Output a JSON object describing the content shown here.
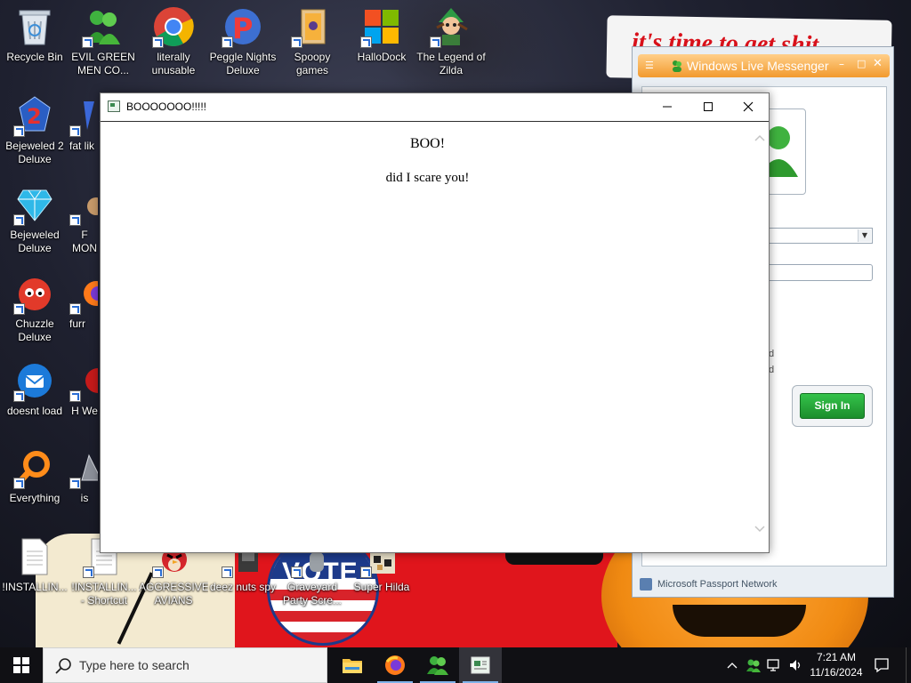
{
  "colors": {
    "taskbar": "#101014",
    "search_box": "#f3f3f3",
    "messenger_title": "#f29a2e",
    "sign_in_green": "#1c8e2c",
    "window_border": "#6f6f6f",
    "wallpaper_red": "#e0151c",
    "pumpkin_orange": "#f08a12"
  },
  "wallpaper": {
    "banner_text": "it's time to get shit",
    "vote_text": "VOTE"
  },
  "desktop_icons": [
    {
      "label": "Recycle Bin",
      "icon": "recycle-bin-icon"
    },
    {
      "label": "EVIL GREEN MEN CO...",
      "icon": "green-men-icon"
    },
    {
      "label": "literally unusable",
      "icon": "chrome-icon"
    },
    {
      "label": "Peggle Nights Deluxe",
      "icon": "peggle-icon"
    },
    {
      "label": "Spoopy games",
      "icon": "folder-icon"
    },
    {
      "label": "HalloDock",
      "icon": "windows-logo-icon"
    },
    {
      "label": "The Legend of Zilda",
      "icon": "zilda-icon"
    },
    {
      "label": "Bejeweled 2 Deluxe",
      "icon": "bejeweled-2-icon"
    },
    {
      "label": "fat lik",
      "icon": "fat-like-icon"
    },
    {
      "label": "Bejeweled Deluxe",
      "icon": "diamond-icon"
    },
    {
      "label": "F MON",
      "icon": "monster-icon"
    },
    {
      "label": "Chuzzle Deluxe",
      "icon": "chuzzle-icon"
    },
    {
      "label": "furr",
      "icon": "firefox-icon"
    },
    {
      "label": "doesnt load",
      "icon": "thunderbird-icon"
    },
    {
      "label": "H We",
      "icon": "red-app-icon"
    },
    {
      "label": "Everything",
      "icon": "everything-search-icon"
    },
    {
      "label": "is",
      "icon": "triangle-app-icon"
    },
    {
      "label": "!INSTALLIN...",
      "icon": "text-file-icon"
    },
    {
      "label": "!INSTALLIN... - Shortcut",
      "icon": "text-file-shortcut-icon"
    },
    {
      "label": "AGGRESSIVE AVIANS",
      "icon": "angry-bird-icon"
    },
    {
      "label": "deez nuts spy",
      "icon": "spy-app-icon"
    },
    {
      "label": "Graveyard Party Scre...",
      "icon": "graveyard-icon"
    },
    {
      "label": "Super Hilda",
      "icon": "super-hilda-icon"
    }
  ],
  "messenger": {
    "title": "Windows Live Messenger",
    "sign_in_label": "Sign In",
    "footer": "Microsoft Passport Network",
    "fragment_1": "d",
    "fragment_2": "d"
  },
  "dialog": {
    "title": "BOOOOOOO!!!!!",
    "heading": "BOO!",
    "text": "did I scare you!"
  },
  "taskbar": {
    "search_placeholder": "Type here to search",
    "apps": [
      {
        "name": "File Explorer",
        "icon": "file-explorer-icon"
      },
      {
        "name": "Firefox",
        "icon": "firefox-icon"
      },
      {
        "name": "Windows Live Messenger",
        "icon": "messenger-icon"
      },
      {
        "name": "BOOOOOOO!!!!!",
        "icon": "dialog-app-icon"
      }
    ],
    "time": "7:21 AM",
    "date": "11/16/2024"
  }
}
